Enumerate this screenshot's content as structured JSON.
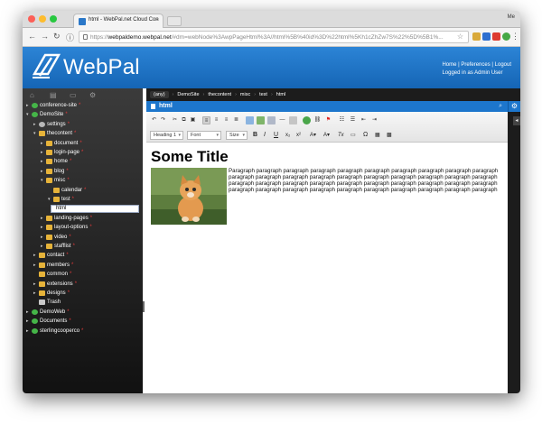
{
  "browser": {
    "tab_title": "html - WebPal.net Cloud Con",
    "tab_close": "×",
    "profile": "Me",
    "url_protocol": "https://",
    "url_host": "webpaldemo.webpal.net",
    "url_rest": "/#dm=webNode%3AwpPageHtml%3A//html%5B%40id%3D%22html%5Kh1cZhZw7S%22%5D%5B1%..."
  },
  "header": {
    "logo_text": "WebPal",
    "links": [
      "Home",
      "Preferences",
      "Logout"
    ],
    "link_sep": "|",
    "logged_in": "Logged in as Admin User"
  },
  "sidebar": {
    "tree": [
      {
        "label": "conference-site",
        "req": true
      },
      {
        "label": "DemoSite",
        "req": true
      },
      {
        "label": "settings",
        "req": true
      },
      {
        "label": "thecontent",
        "req": true
      },
      {
        "label": "document",
        "req": true
      },
      {
        "label": "login-page",
        "req": true
      },
      {
        "label": "home",
        "req": true
      },
      {
        "label": "blog",
        "req": true
      },
      {
        "label": "misc",
        "req": true
      },
      {
        "label": "calendar",
        "req": true
      },
      {
        "label": "test",
        "req": true
      },
      {
        "label": "html",
        "req": false
      },
      {
        "label": "landing-pages",
        "req": true
      },
      {
        "label": "layout-options",
        "req": true
      },
      {
        "label": "video",
        "req": true
      },
      {
        "label": "stafflist",
        "req": true
      },
      {
        "label": "contact",
        "req": true
      },
      {
        "label": "members",
        "req": true
      },
      {
        "label": "common",
        "req": true
      },
      {
        "label": "extensions",
        "req": true
      },
      {
        "label": "designs",
        "req": true
      },
      {
        "label": "Trash",
        "req": false
      },
      {
        "label": "DemoWeb",
        "req": true
      },
      {
        "label": "Documents",
        "req": true
      },
      {
        "label": "sterlingcooperco",
        "req": true
      }
    ],
    "req_mark": "*"
  },
  "breadcrumb": [
    "(any)",
    "DemoSite",
    "thecontent",
    "misc",
    "test",
    "html"
  ],
  "document": {
    "title": "html",
    "gear": "⚙",
    "collapse": "◂"
  },
  "editor": {
    "format_select": "Heading 1",
    "font_select": "Font",
    "size_select": "Size",
    "page_title": "Some Title",
    "paragraph": "Paragraph paragraph paragraph paragraph paragraph paragraph paragraph paragraph paragraph paragraph paragraph paragraph paragraph paragraph paragraph paragraph paragraph paragraph paragraph paragraph paragraph paragraph paragraph paragraph paragraph paragraph paragraph paragraph paragraph paragraph paragraph paragraph paragraph paragraph paragraph paragraph paragraph paragraph paragraph paragraph"
  },
  "colors": {
    "header_blue": "#1d76cc",
    "sidebar_dark": "#1c1c1c",
    "required_red": "#e23a3a"
  }
}
